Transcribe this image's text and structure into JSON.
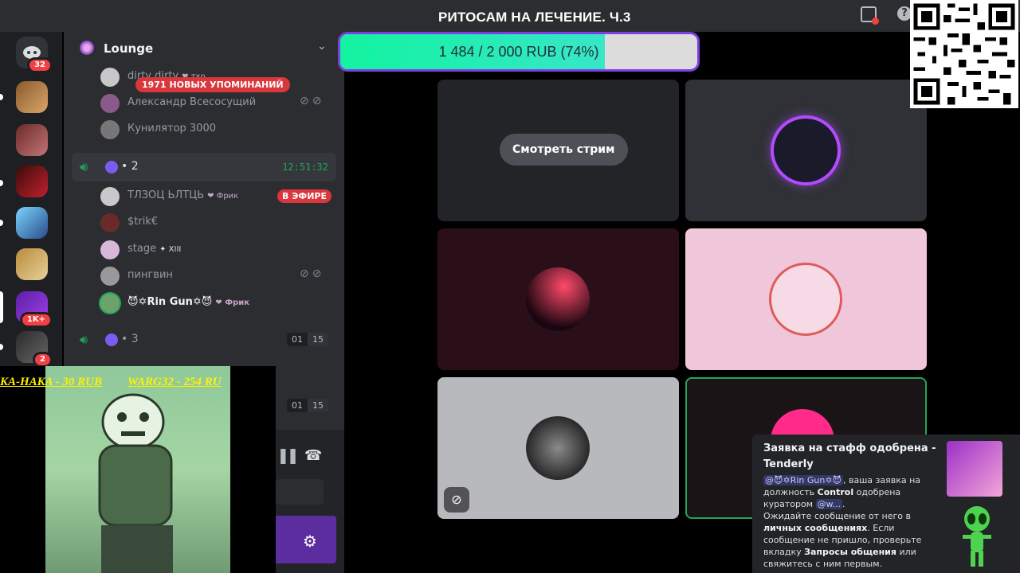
{
  "topbar": {
    "stream_title": "РИТОСАМ НА ЛЕЧЕНИЕ. Ч.3"
  },
  "server_rail": {
    "home_badge": "32",
    "badge_1k": "1K+",
    "badge_2": "2"
  },
  "guild": {
    "name": "Lounge"
  },
  "mentions_pill": "1971 НОВЫХ УПОМИНАНИЙ",
  "members_top": [
    {
      "name": "dirty dirty",
      "tag": "❤ тхо"
    },
    {
      "name": "Александр Всесосущий",
      "tag": ""
    },
    {
      "name": "Кунилятор 3000",
      "tag": ""
    }
  ],
  "voice_channels": [
    {
      "name": "• 2",
      "timer": "12:51:32"
    },
    {
      "name": "• 3",
      "count_a": "01",
      "count_b": "15"
    },
    {
      "count_a": "01",
      "count_b": "15"
    }
  ],
  "members_vc2": [
    {
      "name": "ТЛЗОЦ ЬЛТЦЬ",
      "tag": "❤ Фрик"
    },
    {
      "name": "$trik€",
      "tag": ""
    },
    {
      "name": "stage",
      "tag": "✦ XIII"
    },
    {
      "name": "пингвин",
      "tag": ""
    },
    {
      "name": "😈✡Rin Gun✡😈",
      "tag": "❤ Фрик"
    }
  ],
  "live_badge": "В ЭФИРЕ",
  "goal": {
    "text": "1 484 / 2 000 RUB (74%)",
    "progress": 0.74
  },
  "watch_stream_label": "Смотреть стрим",
  "donors": [
    "KA-HAKA - 30 RUB",
    "WARG32 - 254 RU"
  ],
  "notification": {
    "title": "Заявка на стафф одобрена - Tenderly",
    "mention_user": "@😈✡Rin Gun✡😈",
    "text_1": ", ваша заявка на должность ",
    "role": "Control",
    "text_2": " одобрена куратором ",
    "mention_curator": "@w...",
    "text_3": ".",
    "text_4": "Ожидайте сообщение от него в ",
    "bold_1": "личных сообщениях",
    "text_5": ". Если сообщение не пришло, проверьте вкладку ",
    "bold_2": "Запросы общения",
    "text_6": " или свяжитесь с ним первым."
  },
  "colors": {
    "accent_green": "#23a559",
    "progress_fill": "#12f3a0",
    "goal_border": "#7b3fe4",
    "mention_red": "#da373c"
  }
}
